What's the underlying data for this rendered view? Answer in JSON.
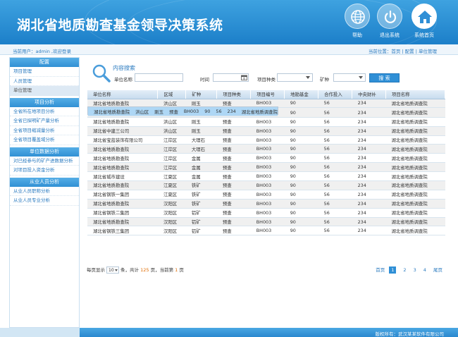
{
  "app": {
    "title": "湖北省地质勘查基金领导决策系统",
    "buttons": {
      "help": "帮助",
      "logout": "退出系统",
      "home": "系统首页"
    }
  },
  "subbar": {
    "user": "当前用户：admin ,欢迎登录",
    "breadcrumb": "当前位置：首页 | 配置 | 单位管理"
  },
  "sidebar": {
    "groups": [
      {
        "title": "配置",
        "items": [
          "项目管理",
          "人员管理",
          "单位管理"
        ]
      },
      {
        "title": "项目分析",
        "items": [
          "全省所在地项目分析",
          "全省已探明矿产量分析",
          "全省项目缩减量分析",
          "全省项目覆盖域分析"
        ]
      },
      {
        "title": "单位数据分析",
        "items": [
          "对已经参与的矿产进数据分析",
          "对项目投入资金分析"
        ]
      },
      {
        "title": "从业人员分析",
        "items": [
          "从业人员职称分析",
          "从业人员专业分析"
        ]
      }
    ],
    "active_item": "单位管理"
  },
  "search": {
    "title": "内容搜索",
    "unit_label": "单位名称",
    "time_label": "时间",
    "type_label": "项目种类",
    "mineral_label": "矿种",
    "button": "搜 索"
  },
  "table": {
    "columns": [
      "单位名称",
      "区域",
      "矿种",
      "项目种类",
      "项目编号",
      "地勘基金",
      "合作投入",
      "中央财补",
      "项目名称"
    ],
    "rows": [
      [
        "湖北省地质勘查院",
        "洪山区",
        "刚玉",
        "预查",
        "BH003",
        "90",
        "56",
        "234",
        "湖北省地质调查院"
      ],
      [
        "湖北省地质勘查院",
        "洪山区",
        "刚玉",
        "预查",
        "BH003",
        "90",
        "56",
        "234",
        "湖北省地质调查院"
      ],
      [
        "湖北省长城建设集团",
        "洪山区",
        "刚玉",
        "预查",
        "BH003",
        "90",
        "56",
        "234",
        "湖北省地质调查院"
      ],
      [
        "湖北省地质勘查院",
        "洪山区",
        "刚玉",
        "预查",
        "BH003",
        "90",
        "56",
        "234",
        "湖北省地质调查院"
      ],
      [
        "湖北省中建三公司",
        "洪山区",
        "刚玉",
        "预查",
        "BH003",
        "90",
        "56",
        "234",
        "湖北省地质调查院"
      ],
      [
        "湖北省宝蓝装饰有限公司",
        "江岸区",
        "大理石",
        "预查",
        "BH003",
        "90",
        "56",
        "234",
        "湖北省地质调查院"
      ],
      [
        "湖北省地质勘查院",
        "江岸区",
        "大理石",
        "预查",
        "BH003",
        "90",
        "56",
        "234",
        "湖北省地质调查院"
      ],
      [
        "湖北省地质勘查院",
        "江岸区",
        "金属",
        "预查",
        "BH003",
        "90",
        "56",
        "234",
        "湖北省地质调查院"
      ],
      [
        "湖北省地质勘查院",
        "江岸区",
        "金属",
        "预查",
        "BH003",
        "90",
        "56",
        "234",
        "湖北省地质调查院"
      ],
      [
        "湖北省城市建设",
        "江夏区",
        "金属",
        "预查",
        "BH003",
        "90",
        "56",
        "234",
        "湖北省地质调查院"
      ],
      [
        "湖北省地质勘查院",
        "江夏区",
        "铁矿",
        "预查",
        "BH003",
        "90",
        "56",
        "234",
        "湖北省地质调查院"
      ],
      [
        "湖北省钢铁一集团",
        "江夏区",
        "铁矿",
        "预查",
        "BH003",
        "90",
        "56",
        "234",
        "湖北省地质调查院"
      ],
      [
        "湖北省地质勘查院",
        "汉阳区",
        "铁矿",
        "预查",
        "BH003",
        "90",
        "56",
        "234",
        "湖北省地质调查院"
      ],
      [
        "湖北省钢铁二集团",
        "汉阳区",
        "铝矿",
        "预查",
        "BH003",
        "90",
        "56",
        "234",
        "湖北省地质调查院"
      ],
      [
        "湖北省地质勘查院",
        "汉阳区",
        "铝矿",
        "预查",
        "BH003",
        "90",
        "56",
        "234",
        "湖北省地质调查院"
      ],
      [
        "湖北省钢铁三集团",
        "汉阳区",
        "铝矿",
        "预查",
        "BH003",
        "90",
        "56",
        "234",
        "湖北省地质调查院"
      ]
    ],
    "selected_row": 1
  },
  "pager": {
    "per_page_label": "每页显示",
    "per_page_value": "10",
    "text_1": "条，共计",
    "total": "125",
    "text_2": "页，当前第",
    "current": "1",
    "text_3": "页",
    "first": "首页",
    "pages": [
      "1",
      "2",
      "3",
      "4"
    ],
    "last": "尾页"
  },
  "footer": {
    "copyright": "版权所有：武汉某某软件有限公司"
  },
  "colors": {
    "primary": "#2f8fd6",
    "header_top": "#3ea2e0",
    "selected_row": "#aed7f5"
  }
}
